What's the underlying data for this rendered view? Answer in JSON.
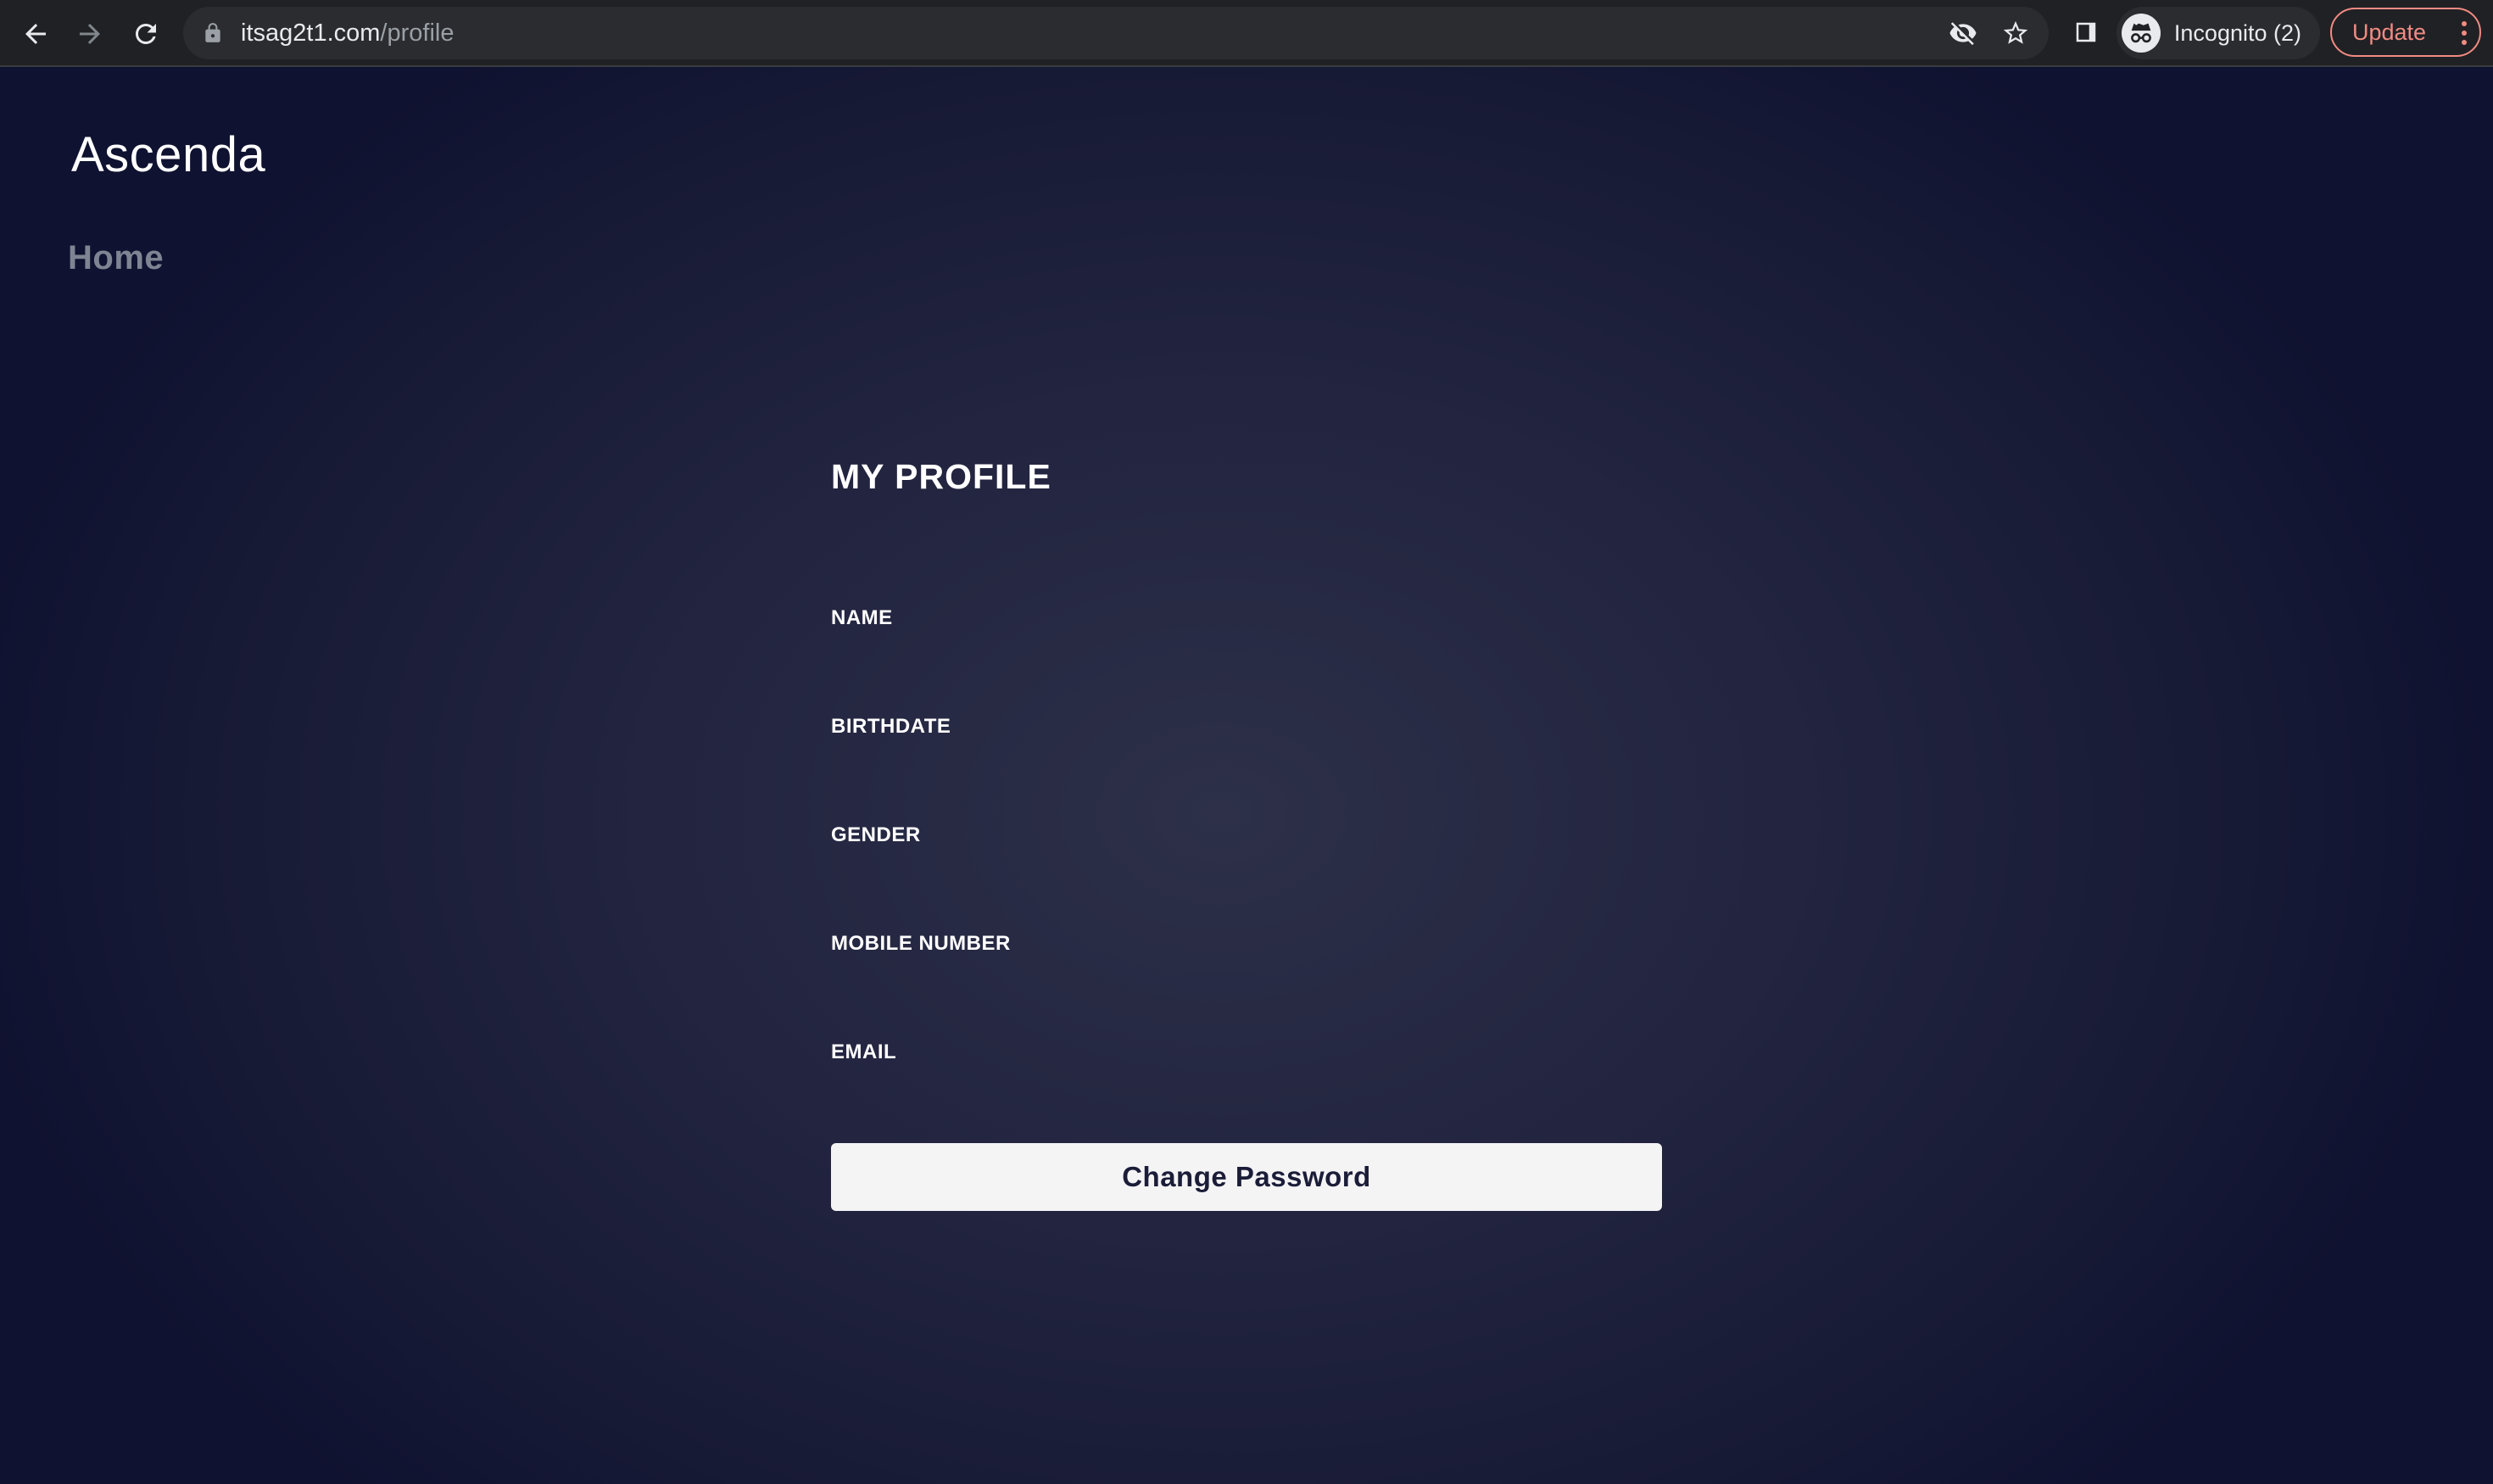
{
  "browser": {
    "url_host": "itsag2t1.com",
    "url_path": "/profile",
    "profile_label": "Incognito (2)",
    "update_label": "Update"
  },
  "site": {
    "logo": "Ascenda",
    "nav": {
      "home": "Home"
    }
  },
  "profile": {
    "title": "MY PROFILE",
    "fields": [
      {
        "label": "NAME"
      },
      {
        "label": "BIRTHDATE"
      },
      {
        "label": "GENDER"
      },
      {
        "label": "MOBILE NUMBER"
      },
      {
        "label": "EMAIL"
      }
    ],
    "change_password_label": "Change Password"
  },
  "colors": {
    "background": "#1f2240",
    "button_bg": "#f4f4f5",
    "button_text": "#1b1d38",
    "update_accent": "#f28b82"
  }
}
